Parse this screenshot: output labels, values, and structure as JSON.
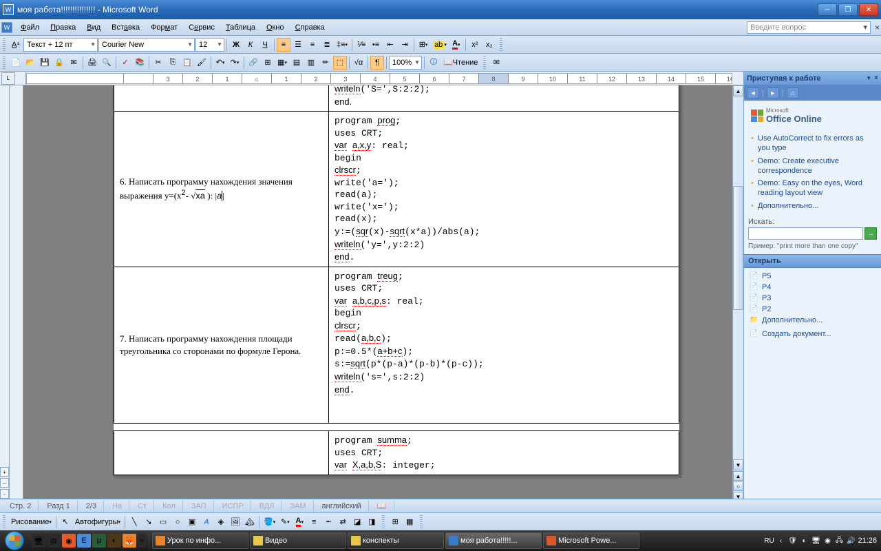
{
  "window": {
    "title": "моя работа!!!!!!!!!!!!!!! - Microsoft Word",
    "doc_icon": "W"
  },
  "menu": {
    "file": "Файл",
    "edit": "Правка",
    "view": "Вид",
    "insert": "Вставка",
    "format": "Формат",
    "service": "Сервис",
    "table": "Таблица",
    "window": "Окно",
    "help": "Справка",
    "ask": "Введите вопрос"
  },
  "format_toolbar": {
    "style": "Текст + 12 пт",
    "font": "Courier New",
    "size": "12"
  },
  "std_toolbar": {
    "zoom": "100%",
    "reading": "Чтение"
  },
  "document": {
    "row0_right_end": "end.",
    "row1_left": "6. Написать программу нахождения значения выражения y=(x²-√(xa)):|a|",
    "row1_right": "program prog;\nuses CRT;\nvar a,x,y: real;\nbegin\nclrscr;\nwrite('a=');\nread(a);\nwrite('x=');\nread(x);\ny:=(sqr(x)-sqrt(x*a))/abs(a);\nwriteln('y=',y:2:2)\nend.",
    "row2_left": "7. Написать программу нахождения площади треугольника со сторонами  по формуле Герона.",
    "row2_right": "program treug;\nuses CRT;\nvar a,b,c,p,s: real;\nbegin\nclrscr;\nread(a,b,c);\np:=0.5*(a+b+c);\ns:=sqrt(p*(p-a)*(p-b)*(p-c));\nwriteln('s=',s:2:2)\nend.",
    "row3_right": "program summa;\nuses CRT;\nvar X,a,b,S: integer;"
  },
  "taskpane": {
    "title": "Приступая к работе",
    "office_sup": "Microsoft",
    "office": "Office Online",
    "links": [
      "Use AutoCorrect to fix errors as you type",
      "Demo: Create executive correspondence",
      "Demo: Easy on the eyes, Word reading layout view",
      "Дополнительно..."
    ],
    "search_label": "Искать:",
    "search_hint": "Пример:  \"print more than one copy\"",
    "open_section": "Открыть",
    "recent": [
      "P5",
      "P4",
      "P3",
      "P2"
    ],
    "more": "Дополнительно...",
    "create": "Создать документ..."
  },
  "drawbar": {
    "drawing": "Рисование",
    "autoshapes": "Автофигуры"
  },
  "status": {
    "page": "Стр. 2",
    "section": "Разд 1",
    "pages": "2/3",
    "at": "На",
    "line": "Ст",
    "col": "Кол",
    "rec": "ЗАП",
    "trk": "ИСПР",
    "ext": "ВДЛ",
    "ovr": "ЗАМ",
    "lang": "английский"
  },
  "taskbar": {
    "tasks": [
      {
        "label": "Урок по инфо...",
        "icon": "📄"
      },
      {
        "label": "Видео",
        "icon": "📁"
      },
      {
        "label": "конспекты",
        "icon": "📁"
      },
      {
        "label": "моя работа!!!!!...",
        "icon": "W",
        "active": true
      },
      {
        "label": "Microsoft Powe...",
        "icon": "P"
      }
    ],
    "lang": "RU",
    "time": "21:26"
  }
}
